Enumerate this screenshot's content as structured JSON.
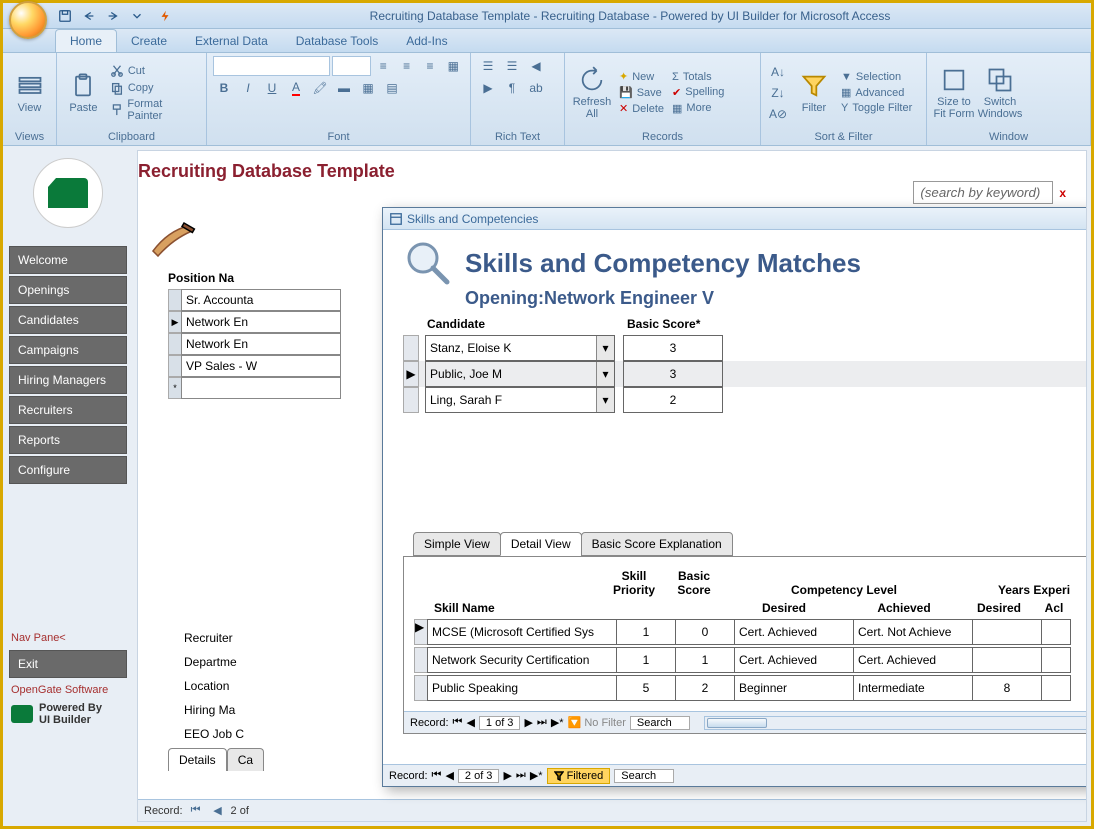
{
  "titlebar": {
    "title": "Recruiting Database Template - Recruiting Database - Powered by UI Builder for Microsoft Access"
  },
  "ribbon": {
    "tabs": [
      "Home",
      "Create",
      "External Data",
      "Database Tools",
      "Add-Ins"
    ],
    "active": 0,
    "groups": {
      "views": {
        "label": "Views",
        "view": "View"
      },
      "clipboard": {
        "label": "Clipboard",
        "paste": "Paste",
        "cut": "Cut",
        "copy": "Copy",
        "format_painter": "Format Painter"
      },
      "font": {
        "label": "Font"
      },
      "richtext": {
        "label": "Rich Text"
      },
      "records": {
        "label": "Records",
        "refresh": "Refresh All",
        "new": "New",
        "save": "Save",
        "delete": "Delete",
        "totals": "Totals",
        "spelling": "Spelling",
        "more": "More"
      },
      "sortfilter": {
        "label": "Sort & Filter",
        "filter": "Filter",
        "selection": "Selection",
        "advanced": "Advanced",
        "toggle": "Toggle Filter"
      },
      "window": {
        "label": "Window",
        "sizefit": "Size to Fit Form",
        "switch": "Switch Windows"
      }
    }
  },
  "nav": {
    "items": [
      "Welcome",
      "Openings",
      "Candidates",
      "Campaigns",
      "Hiring Managers",
      "Recruiters",
      "Reports",
      "Configure"
    ],
    "navpane": "Nav Pane<",
    "exit": "Exit",
    "company": "OpenGate Software",
    "powered1": "Powered By",
    "powered2": "UI Builder"
  },
  "heading": "Recruiting Database Template",
  "search": {
    "placeholder": "(search by keyword)",
    "x": "x"
  },
  "positions": {
    "header": "Position Na",
    "rows": [
      "Sr. Accounta",
      "Network En",
      "Network En",
      "VP Sales - W"
    ]
  },
  "detail_tabs": [
    "Details",
    "Ca"
  ],
  "detail_fields": [
    "Recruiter",
    "Departme",
    "Location",
    "Hiring Ma",
    "EEO Job C"
  ],
  "record_nav": {
    "label": "Record:",
    "pos": "2 of"
  },
  "popup": {
    "title": "Skills and Competencies",
    "h1": "Skills and Competency Matches",
    "h2_label": "Opening:",
    "h2_value": "Network Engineer V",
    "cand_hdr": [
      "Candidate",
      "Basic Score*"
    ],
    "candidates": [
      {
        "name": "Stanz, Eloise K",
        "score": "3",
        "active": false
      },
      {
        "name": "Public, Joe M",
        "score": "3",
        "active": true
      },
      {
        "name": "Ling, Sarah F",
        "score": "2",
        "active": false
      }
    ],
    "sub_tabs": [
      "Simple View",
      "Detail View",
      "Basic Score Explanation"
    ],
    "sub_active": 1,
    "skill_headers": {
      "name": "Skill Name",
      "priority": "Skill Priority",
      "score": "Basic Score",
      "comp": "Competency Level",
      "years": "Years Experi",
      "desired": "Desired",
      "achieved": "Achieved",
      "yd": "Desired",
      "ya": "Acl"
    },
    "skills": [
      {
        "name": "MCSE (Microsoft Certified Sys",
        "priority": "1",
        "score": "0",
        "desired": "Cert. Achieved",
        "achieved": "Cert. Not Achieve",
        "yd": "",
        "ya": ""
      },
      {
        "name": "Network Security Certification",
        "priority": "1",
        "score": "1",
        "desired": "Cert. Achieved",
        "achieved": "Cert. Achieved",
        "yd": "",
        "ya": ""
      },
      {
        "name": "Public Speaking",
        "priority": "5",
        "score": "2",
        "desired": "Beginner",
        "achieved": "Intermediate",
        "yd": "8",
        "ya": ""
      }
    ],
    "inner_nav": {
      "label": "Record:",
      "pos": "1 of 3",
      "filter": "No Filter",
      "search": "Search"
    },
    "outer_nav": {
      "label": "Record:",
      "pos": "2 of 3",
      "filter": "Filtered",
      "search": "Search"
    }
  }
}
